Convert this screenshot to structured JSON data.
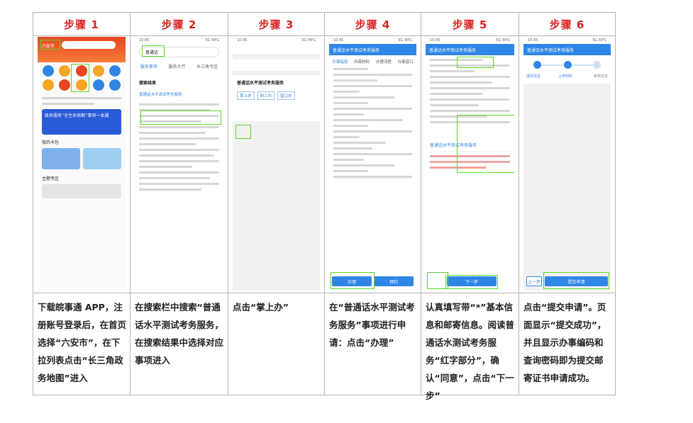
{
  "steps": [
    {
      "title": "步骤 1",
      "desc": "下载皖事通 APP，注册账号登录后，在首页选择“六安市”，在下拉列表点击“长三角政务地图”进入"
    },
    {
      "title": "步骤 2",
      "desc": "在搜索栏中搜索“普通话水平测试考务服务，在搜索结果中选择对应事项进入"
    },
    {
      "title": "步骤 3",
      "desc": "点击“掌上办”"
    },
    {
      "title": "步骤 4",
      "desc": "在“普通话水平测试考务服务”事项进行申请：点击“办理”"
    },
    {
      "title": "步骤 5",
      "desc": "认真填写带“*”基本信息和邮寄信息。阅读普通话水测试考务服务“红字部分”，确认“同意”，点击“下一步”"
    },
    {
      "title": "步骤 6",
      "desc": "点击“提交申请”。页面显示“提交成功”，并且显示办事编码和查询密码即为提交邮寄证书申请成功。"
    }
  ],
  "screens": {
    "s1": {
      "city": "六安市",
      "banner1": "新年 快乐",
      "banner2": "政务服务“全生命周期”事项一本通",
      "section1": "我的卡包",
      "section2": "主题专区"
    },
    "s2": {
      "search": "普通话",
      "tabs": [
        "服务事项",
        "服务大厅",
        "长三角专区"
      ],
      "section": "搜索结果",
      "first": "普通话水平测试考务服务"
    },
    "s3": {
      "item": "普通话水平测试考务服务",
      "tags": [
        "掌上办",
        "网上办",
        "窗口办"
      ]
    },
    "s4": {
      "title": "普通话水平测试考务服务",
      "tabs": [
        "办事指南",
        "所需材料",
        "办理流程",
        "办事窗口"
      ],
      "btn_do": "办理",
      "btn_book": "预约"
    },
    "s5": {
      "title": "普通话水平测试考务服务",
      "notice_title": "普通话水平测试考务服务",
      "btn_next": "下一步"
    },
    "s6": {
      "title": "普通话水平测试考务服务",
      "steps": [
        "填写信息",
        "上传材料",
        "审核信息"
      ],
      "btn_prev": "上一步",
      "btn_submit": "提交申请"
    }
  },
  "colors": {
    "header_red": "#d8231f",
    "phone_blue": "#2f86e6",
    "highlight": "#5bd62a"
  }
}
